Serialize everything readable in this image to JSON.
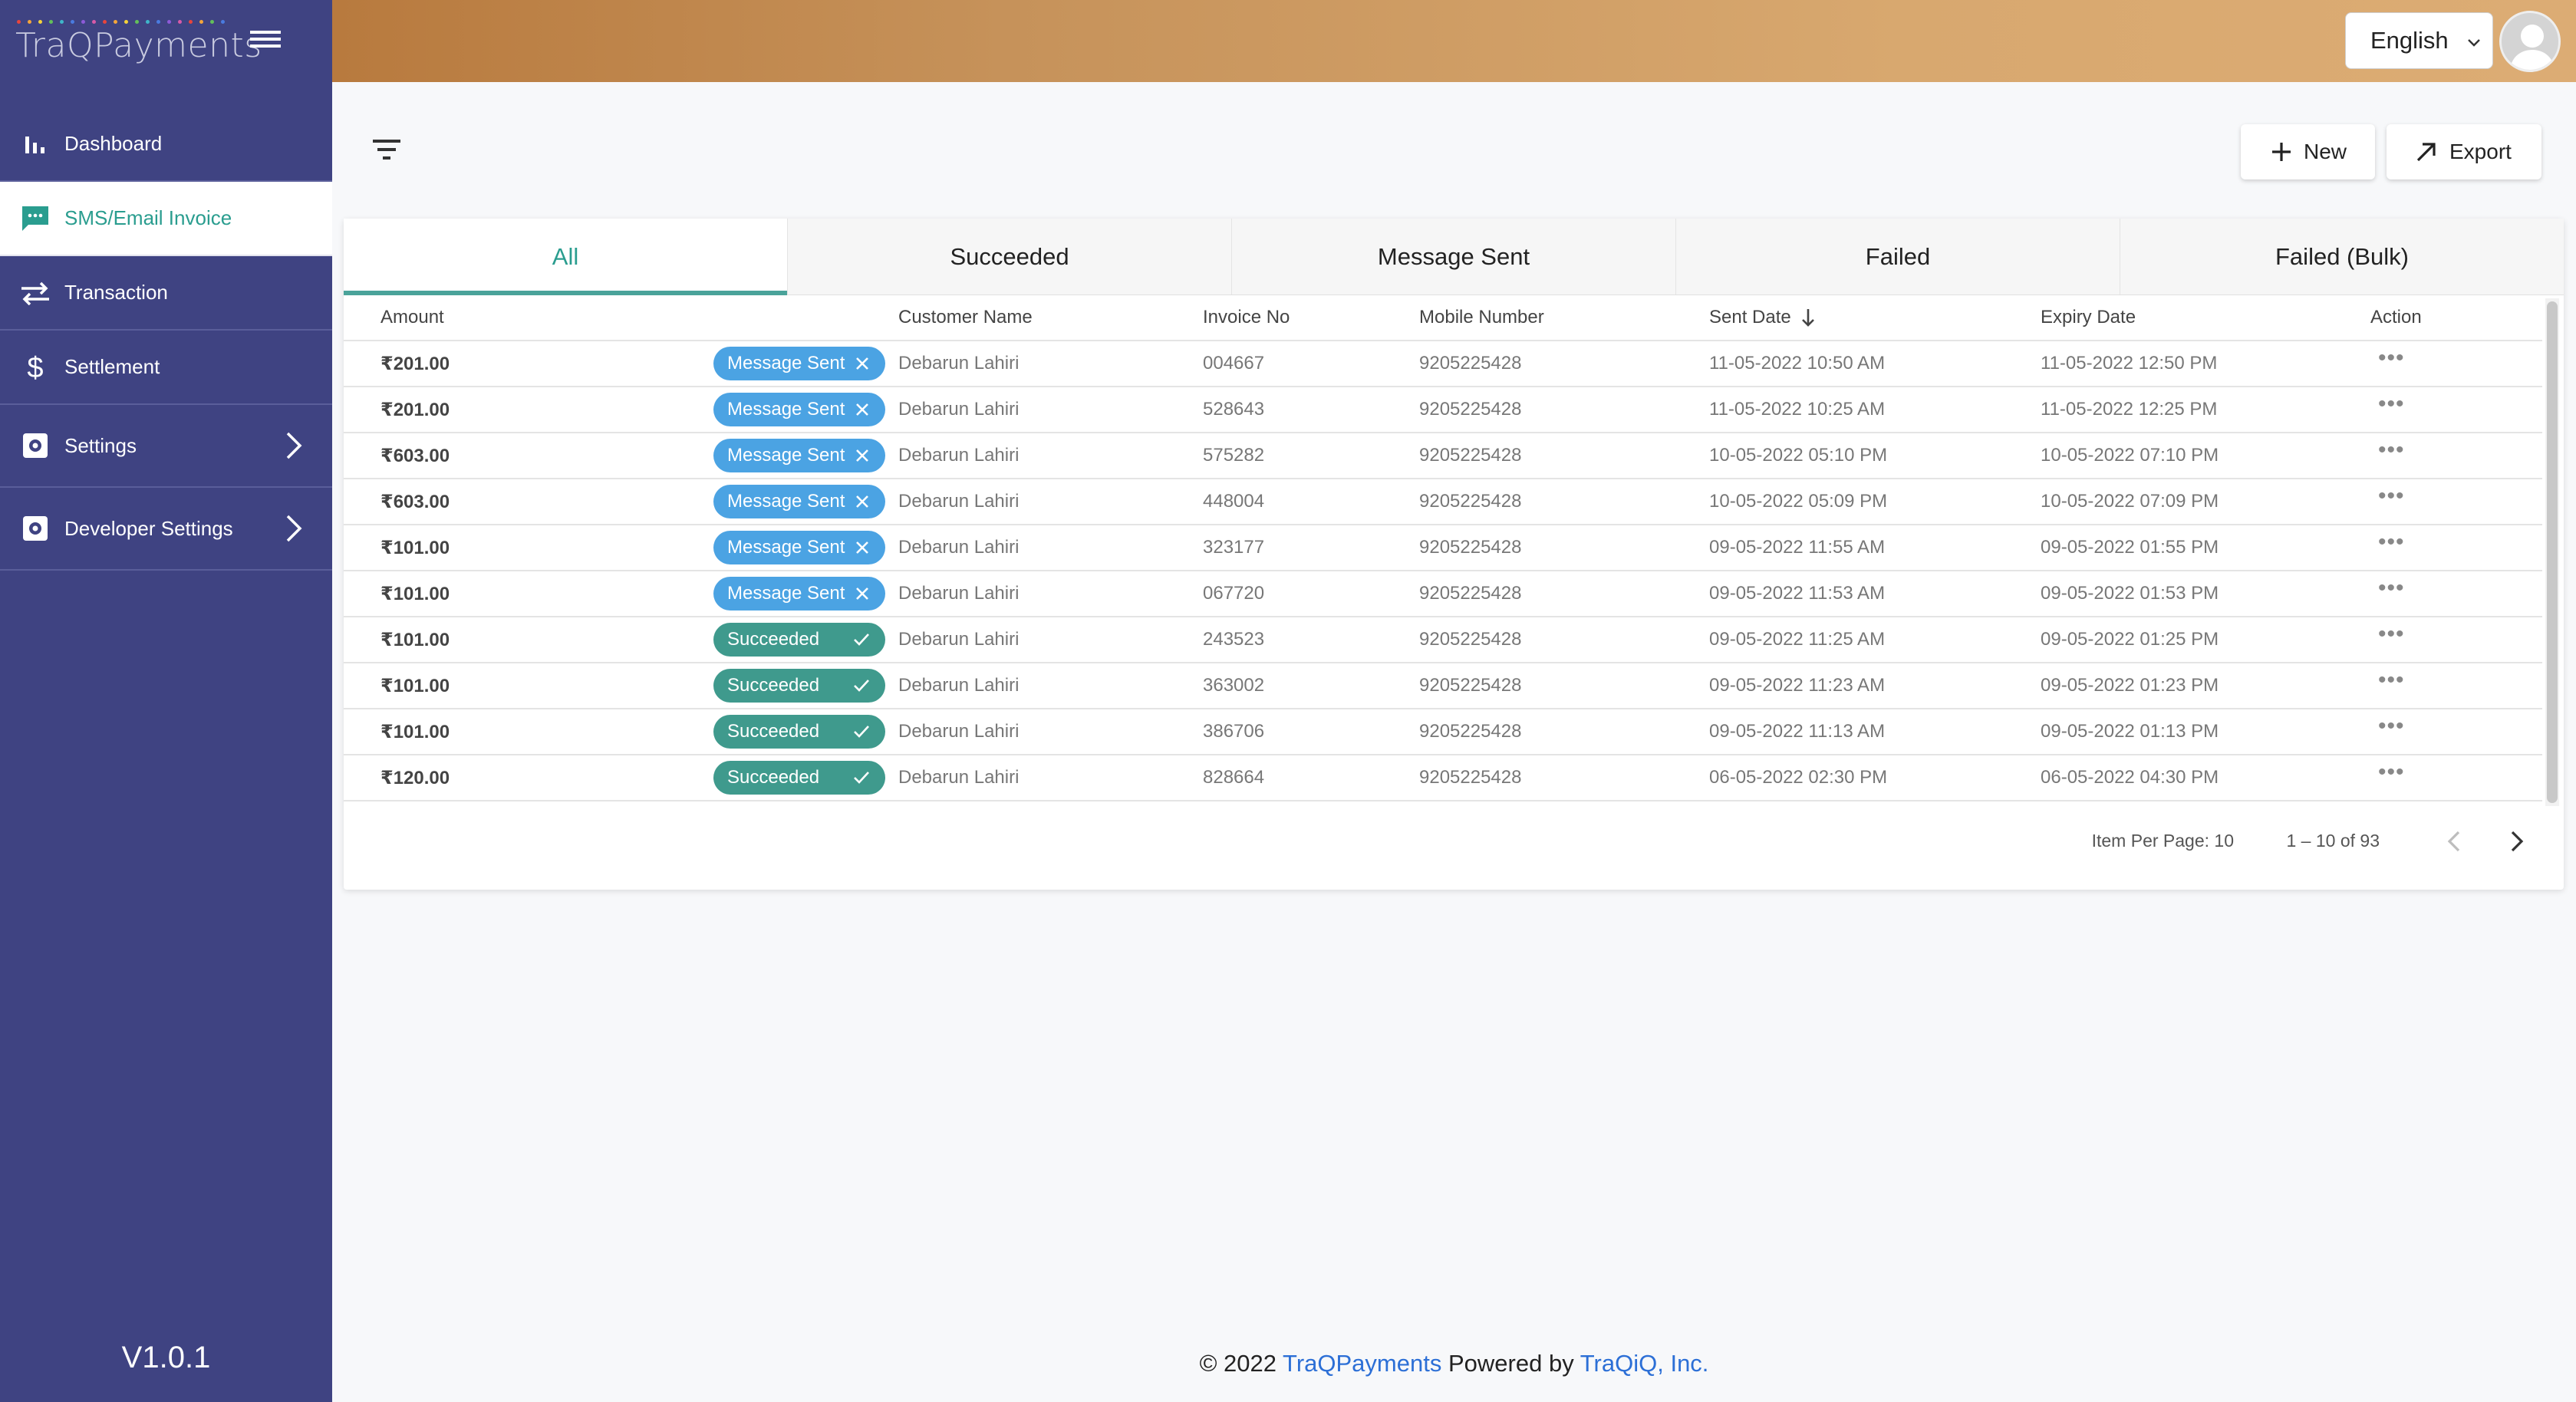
{
  "brand": {
    "name": "TraQPayments"
  },
  "sidebar": {
    "items": [
      {
        "label": "Dashboard",
        "icon": "bar-chart-icon"
      },
      {
        "label": "SMS/Email Invoice",
        "icon": "message-icon",
        "active": true
      },
      {
        "label": "Transaction",
        "icon": "swap-arrows-icon"
      },
      {
        "label": "Settlement",
        "icon": "dollar-icon"
      },
      {
        "label": "Settings",
        "icon": "gear-icon"
      },
      {
        "label": "Developer Settings",
        "icon": "gear-icon"
      }
    ],
    "version": "V1.0.1"
  },
  "header": {
    "language": "English"
  },
  "toolbar": {
    "new_label": "New",
    "export_label": "Export"
  },
  "tabs": [
    "All",
    "Succeeded",
    "Message Sent",
    "Failed",
    "Failed (Bulk)"
  ],
  "table": {
    "columns": {
      "amount": "Amount",
      "customer": "Customer Name",
      "invoice": "Invoice No",
      "mobile": "Mobile Number",
      "sent": "Sent Date",
      "expiry": "Expiry Date",
      "action": "Action"
    },
    "rows": [
      {
        "amount": "₹201.00",
        "status": "Message Sent",
        "customer": "Debarun Lahiri",
        "invoice": "004667",
        "mobile": "9205225428",
        "sent": "11-05-2022 10:50 AM",
        "expiry": "11-05-2022 12:50 PM",
        "action": "•••"
      },
      {
        "amount": "₹201.00",
        "status": "Message Sent",
        "customer": "Debarun Lahiri",
        "invoice": "528643",
        "mobile": "9205225428",
        "sent": "11-05-2022 10:25 AM",
        "expiry": "11-05-2022 12:25 PM",
        "action": "•••"
      },
      {
        "amount": "₹603.00",
        "status": "Message Sent",
        "customer": "Debarun Lahiri",
        "invoice": "575282",
        "mobile": "9205225428",
        "sent": "10-05-2022 05:10 PM",
        "expiry": "10-05-2022 07:10 PM",
        "action": "•••"
      },
      {
        "amount": "₹603.00",
        "status": "Message Sent",
        "customer": "Debarun Lahiri",
        "invoice": "448004",
        "mobile": "9205225428",
        "sent": "10-05-2022 05:09 PM",
        "expiry": "10-05-2022 07:09 PM",
        "action": "•••"
      },
      {
        "amount": "₹101.00",
        "status": "Message Sent",
        "customer": "Debarun Lahiri",
        "invoice": "323177",
        "mobile": "9205225428",
        "sent": "09-05-2022 11:55 AM",
        "expiry": "09-05-2022 01:55 PM",
        "action": "•••"
      },
      {
        "amount": "₹101.00",
        "status": "Message Sent",
        "customer": "Debarun Lahiri",
        "invoice": "067720",
        "mobile": "9205225428",
        "sent": "09-05-2022 11:53 AM",
        "expiry": "09-05-2022 01:53 PM",
        "action": "•••"
      },
      {
        "amount": "₹101.00",
        "status": "Succeeded",
        "customer": "Debarun Lahiri",
        "invoice": "243523",
        "mobile": "9205225428",
        "sent": "09-05-2022 11:25 AM",
        "expiry": "09-05-2022 01:25 PM",
        "action": "•••"
      },
      {
        "amount": "₹101.00",
        "status": "Succeeded",
        "customer": "Debarun Lahiri",
        "invoice": "363002",
        "mobile": "9205225428",
        "sent": "09-05-2022 11:23 AM",
        "expiry": "09-05-2022 01:23 PM",
        "action": "•••"
      },
      {
        "amount": "₹101.00",
        "status": "Succeeded",
        "customer": "Debarun Lahiri",
        "invoice": "386706",
        "mobile": "9205225428",
        "sent": "09-05-2022 11:13 AM",
        "expiry": "09-05-2022 01:13 PM",
        "action": "•••"
      },
      {
        "amount": "₹120.00",
        "status": "Succeeded",
        "customer": "Debarun Lahiri",
        "invoice": "828664",
        "mobile": "9205225428",
        "sent": "06-05-2022 02:30 PM",
        "expiry": "06-05-2022 04:30 PM",
        "action": "•••"
      }
    ]
  },
  "pagination": {
    "per_page": "Item Per Page: 10",
    "range": "1 – 10 of 93"
  },
  "footer": {
    "copyright": "© 2022",
    "brand_link": "TraQPayments",
    "powered": "Powered by",
    "company_link": "TraQiQ, Inc."
  },
  "colors": {
    "sidebar": "#3f4382",
    "accent": "#2a9d8f",
    "sent_badge": "#4ba3e3",
    "success_badge": "#3f9a8d"
  }
}
